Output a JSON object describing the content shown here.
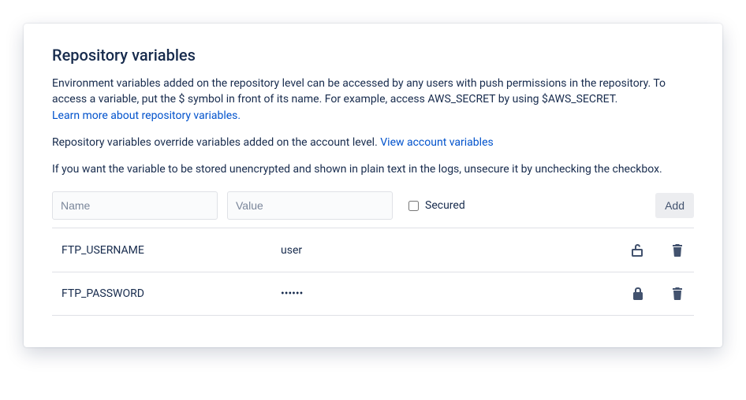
{
  "heading": "Repository variables",
  "intro_text": "Environment variables added on the repository level can be accessed by any users with push permissions in the repository. To access a variable, put the $ symbol in front of its name. For example, access AWS_SECRET by using $AWS_SECRET.",
  "learn_more_link": "Learn more about repository variables.",
  "override_text": "Repository variables override variables added on the account level. ",
  "view_account_link": "View account variables",
  "unsecure_text": "If you want the variable to be stored unencrypted and shown in plain text in the logs, unsecure it by unchecking the checkbox.",
  "form": {
    "name_placeholder": "Name",
    "value_placeholder": "Value",
    "secured_label": "Secured",
    "add_button": "Add"
  },
  "variables": [
    {
      "name": "FTP_USERNAME",
      "value": "user",
      "secured": false
    },
    {
      "name": "FTP_PASSWORD",
      "value": "••••••",
      "secured": true
    }
  ]
}
